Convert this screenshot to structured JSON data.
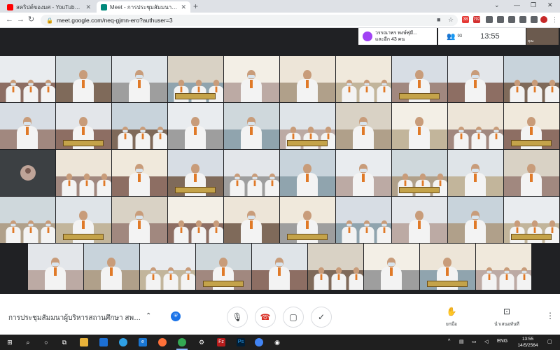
{
  "browser": {
    "tabs": [
      {
        "title": "สคริปต์ของมศ - YouTube Studio",
        "favicon_color": "#ff0000"
      },
      {
        "title": "Meet - การประชุมสัมมนาผู้บริหาร",
        "favicon_color": "#00897b"
      }
    ],
    "url": "meet.google.com/neq-gjmn-ero?authuser=3",
    "extensions": [
      {
        "icon": "youtube-ext-icon",
        "badge": "38",
        "color": "#e53935"
      },
      {
        "icon": "calendar-ext-icon",
        "badge": "792",
        "color": "#d32f2f"
      },
      {
        "icon": "puzzle-ext-icon",
        "badge": "",
        "color": "#5f6368"
      },
      {
        "icon": "grid-ext-icon",
        "badge": "",
        "color": "#5f6368"
      },
      {
        "icon": "screen-ext-icon",
        "badge": "",
        "color": "#5f6368"
      },
      {
        "icon": "shield-ext-icon",
        "badge": "",
        "color": "#5f6368"
      },
      {
        "icon": "puzzle-piece-icon",
        "badge": "",
        "color": "#5f6368"
      },
      {
        "icon": "download-icon",
        "badge": "",
        "color": "#5f6368"
      },
      {
        "icon": "profile-icon",
        "badge": "",
        "color": "#c62828"
      }
    ]
  },
  "meet": {
    "speaker": {
      "name": "วรรณาพร พงษ์พุ่มี...",
      "others": "และอีก 43 คน"
    },
    "participant_count": "93",
    "time": "13:55",
    "self_name": "คุณ",
    "meeting_title": "การประชุมสัมมนาผู้บริหารสถานศึกษา สพป ไป...",
    "actions": {
      "raise_hand": "ยกมือ",
      "present": "นำเสนอทันที"
    }
  },
  "taskbar": {
    "lang": "ENG",
    "time": "13:55",
    "date": "14/5/2564"
  }
}
